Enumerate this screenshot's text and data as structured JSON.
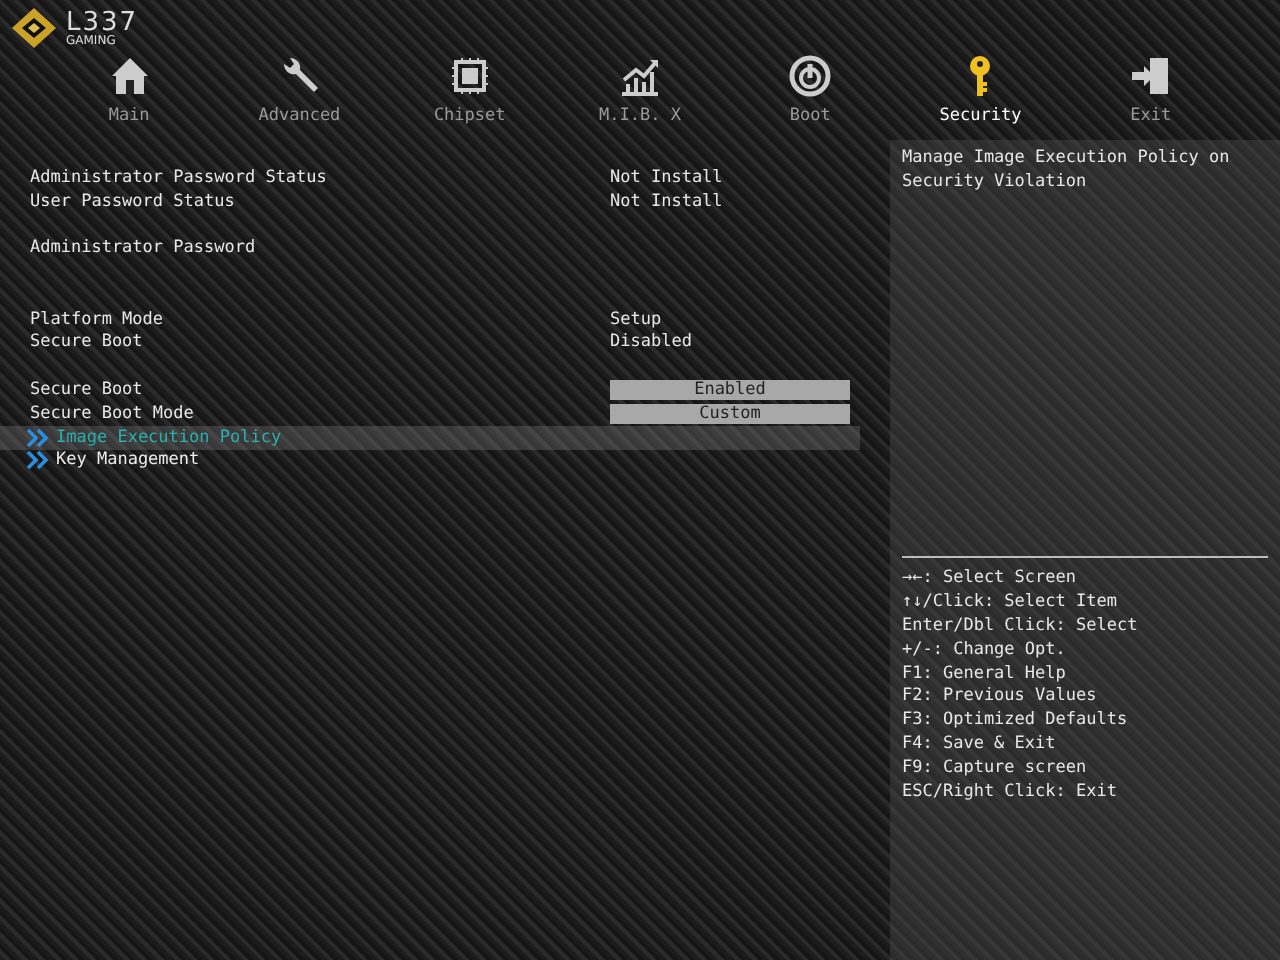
{
  "logo": {
    "title": "L337",
    "subtitle": "GAMING"
  },
  "tabs": [
    {
      "label": "Main",
      "kind": "home",
      "selected": false
    },
    {
      "label": "Advanced",
      "kind": "wrench",
      "selected": false
    },
    {
      "label": "Chipset",
      "kind": "chip",
      "selected": false
    },
    {
      "label": "M.I.B. X",
      "kind": "chart",
      "selected": false
    },
    {
      "label": "Boot",
      "kind": "power",
      "selected": false
    },
    {
      "label": "Security",
      "kind": "key",
      "selected": true
    },
    {
      "label": "Exit",
      "kind": "exit",
      "selected": false
    }
  ],
  "settings": [
    {
      "kind": "info",
      "label": "Administrator Password Status",
      "value": "Not Install"
    },
    {
      "kind": "info",
      "label": "User Password Status",
      "value": "Not Install"
    },
    {
      "kind": "blank"
    },
    {
      "kind": "info",
      "label": "Administrator Password"
    },
    {
      "kind": "blank"
    },
    {
      "kind": "blank"
    },
    {
      "kind": "info",
      "label": "Platform Mode",
      "value": "Setup"
    },
    {
      "kind": "info",
      "label": "Secure Boot",
      "value": "Disabled"
    },
    {
      "kind": "blank"
    },
    {
      "kind": "option",
      "label": "Secure Boot",
      "value": "Enabled"
    },
    {
      "kind": "option",
      "label": "Secure Boot Mode",
      "value": "Custom"
    },
    {
      "kind": "submenu",
      "label": "Image Execution Policy",
      "selected": true
    },
    {
      "kind": "submenu",
      "label": "Key Management",
      "selected": false
    }
  ],
  "help": "Manage Image Execution Policy on Security Violation",
  "keys": [
    "→←: Select Screen",
    "↑↓/Click: Select Item",
    "Enter/Dbl Click: Select",
    "+/-: Change Opt.",
    "F1: General Help",
    "F2: Previous Values",
    "F3: Optimized Defaults",
    "F4: Save & Exit",
    "F9: Capture screen",
    "ESC/Right Click: Exit"
  ]
}
